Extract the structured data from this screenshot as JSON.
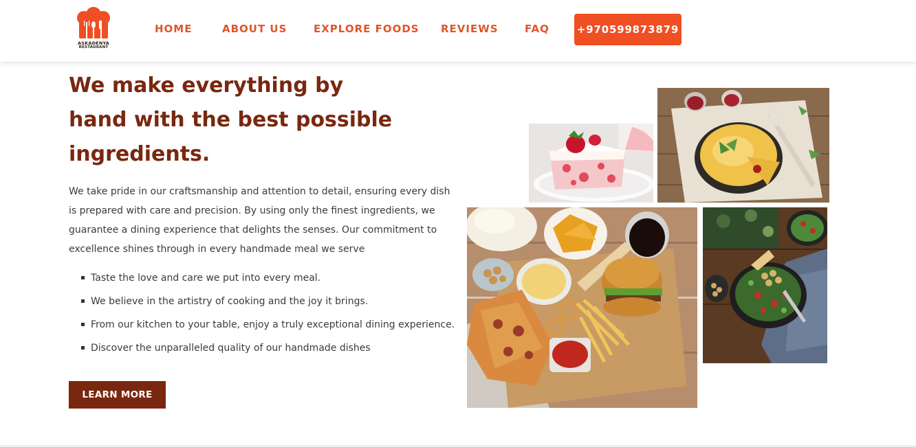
{
  "brand": {
    "logo_line1": "ASKADENYA",
    "logo_line2": "RESTAURANT",
    "logo_icon": "chef-hat-utensils-icon",
    "accent_color": "#f04e23",
    "heading_color": "#7a2710"
  },
  "nav": {
    "links": [
      {
        "label": "HOME"
      },
      {
        "label": "ABOUT US"
      },
      {
        "label": "EXPLORE FOODS"
      },
      {
        "label": "REVIEWS"
      },
      {
        "label": "FAQ"
      }
    ],
    "phone": "+970599873879"
  },
  "hero": {
    "heading_line1": "We make everything by",
    "heading_line2": "hand with the best possible",
    "heading_line3": "ingredients.",
    "paragraph": "We take pride in our craftsmanship and attention to detail, ensuring every dish is prepared with care and precision. By using only the finest ingredients, we guarantee a dining experience that delights the senses. Our commitment to excellence shines through in every handmade meal we serve",
    "bullets": [
      "Taste the love and care we put into every meal.",
      "We believe in the artistry of cooking and the joy it brings.",
      "From our kitchen to your table, enjoy a truly exceptional dining experience.",
      "Discover the unparalleled quality of our handmade dishes"
    ],
    "button_label": "LEARN MORE"
  },
  "gallery": {
    "photos": [
      {
        "subject": "strawberry-cake-photo"
      },
      {
        "subject": "frittata-pie-photo"
      },
      {
        "subject": "fast-food-platter-photo"
      },
      {
        "subject": "salad-bowl-photo"
      }
    ]
  }
}
